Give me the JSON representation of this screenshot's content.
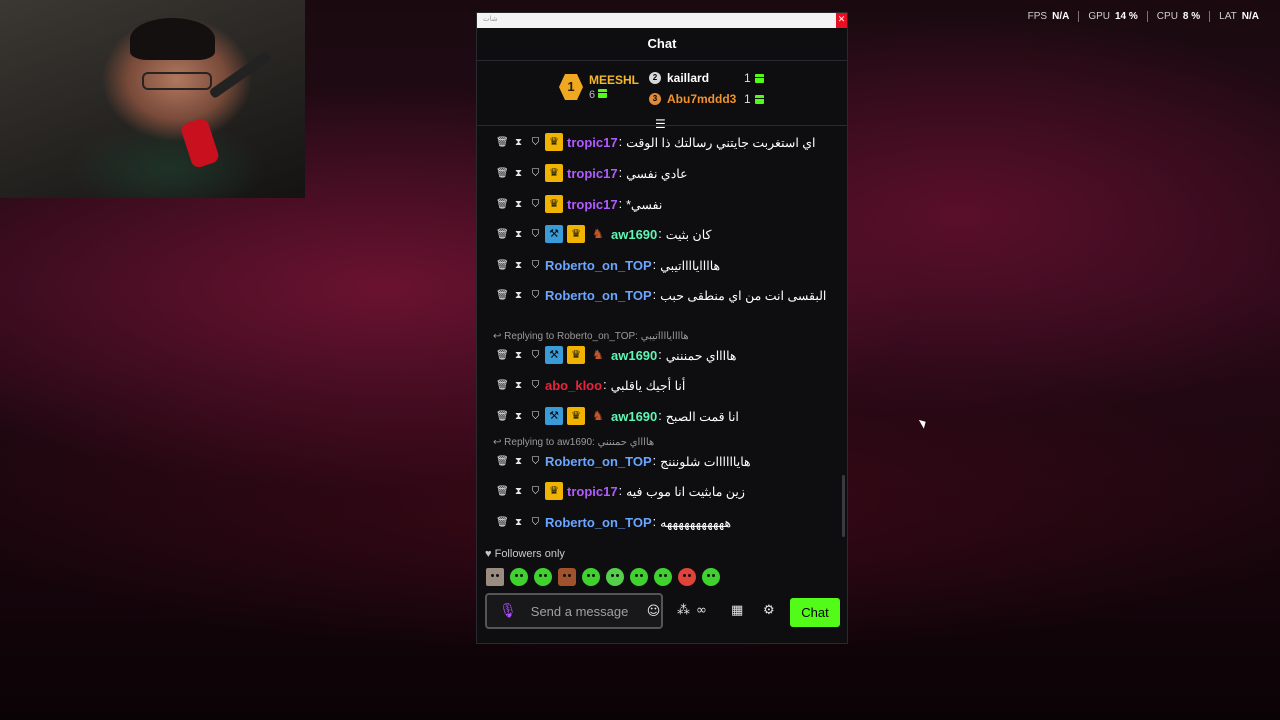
{
  "stats": [
    {
      "label": "FPS",
      "value": "N/A"
    },
    {
      "label": "GPU",
      "value": "14 %"
    },
    {
      "label": "CPU",
      "value": "8 %"
    },
    {
      "label": "LAT",
      "value": "N/A"
    }
  ],
  "window": {
    "title": "شات",
    "close": "✕"
  },
  "chat": {
    "header": "Chat",
    "leaderboard": {
      "first": {
        "rank": "1",
        "name": "MEESHL",
        "count": "6"
      },
      "second": {
        "rank": "2",
        "name": "kaillard",
        "count": "1"
      },
      "third": {
        "rank": "3",
        "name": "Abu7mddd3",
        "count": "1"
      }
    },
    "messages": [
      {
        "user": "tropic17",
        "text": "اي استغربت جايتني رسالتك ذا الوقت"
      },
      {
        "user": "tropic17",
        "text": "عادي نفسي"
      },
      {
        "user": "tropic17",
        "text": "نفسي*"
      },
      {
        "user": "aw1690",
        "text": "كان بثيت"
      },
      {
        "user": "Roberto_on_TOP",
        "text": "هاااايااااتيبي"
      },
      {
        "user": "Roberto_on_TOP",
        "text": "البقسى انت من اي منطقى حبب"
      },
      {
        "reply": "Replying to Roberto_on_TOP: هاااايااااتيبي"
      },
      {
        "user": "aw1690",
        "text": "هااااي حمننني"
      },
      {
        "user": "abo_kloo",
        "text": "أنا أجيك ياقلبي"
      },
      {
        "user": "aw1690",
        "text": "انا قمت الصبح"
      },
      {
        "reply": "Replying to aw1690: هااااي حمننني"
      },
      {
        "user": "Roberto_on_TOP",
        "text": "هاياااااات شلونننج"
      },
      {
        "user": "tropic17",
        "text": "زين مابثيت انا موب فيه"
      },
      {
        "user": "Roberto_on_TOP",
        "text": "هههههههههههه"
      }
    ],
    "followers_only": "Followers only",
    "input_placeholder": "Send a message",
    "send_label": "Chat"
  },
  "colors": {
    "accent": "#53fc18",
    "tropic17": "#b25bff",
    "aw1690": "#5ef7b5",
    "Roberto_on_TOP": "#6aa6ff",
    "abo_kloo": "#e8253d",
    "gold": "#f5b82b"
  }
}
